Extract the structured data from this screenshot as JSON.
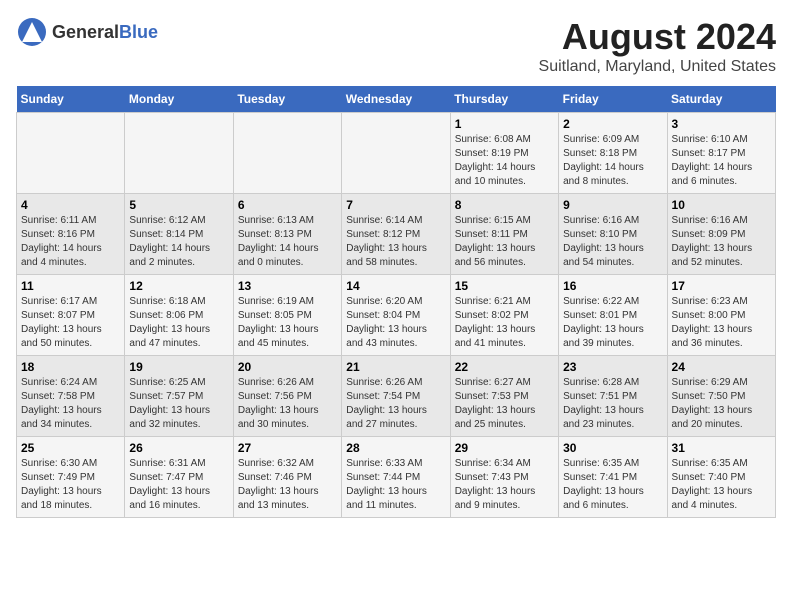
{
  "logo": {
    "general": "General",
    "blue": "Blue"
  },
  "title": "August 2024",
  "subtitle": "Suitland, Maryland, United States",
  "days_of_week": [
    "Sunday",
    "Monday",
    "Tuesday",
    "Wednesday",
    "Thursday",
    "Friday",
    "Saturday"
  ],
  "weeks": [
    [
      {
        "day": "",
        "info": ""
      },
      {
        "day": "",
        "info": ""
      },
      {
        "day": "",
        "info": ""
      },
      {
        "day": "",
        "info": ""
      },
      {
        "day": "1",
        "info": "Sunrise: 6:08 AM\nSunset: 8:19 PM\nDaylight: 14 hours and 10 minutes."
      },
      {
        "day": "2",
        "info": "Sunrise: 6:09 AM\nSunset: 8:18 PM\nDaylight: 14 hours and 8 minutes."
      },
      {
        "day": "3",
        "info": "Sunrise: 6:10 AM\nSunset: 8:17 PM\nDaylight: 14 hours and 6 minutes."
      }
    ],
    [
      {
        "day": "4",
        "info": "Sunrise: 6:11 AM\nSunset: 8:16 PM\nDaylight: 14 hours and 4 minutes."
      },
      {
        "day": "5",
        "info": "Sunrise: 6:12 AM\nSunset: 8:14 PM\nDaylight: 14 hours and 2 minutes."
      },
      {
        "day": "6",
        "info": "Sunrise: 6:13 AM\nSunset: 8:13 PM\nDaylight: 14 hours and 0 minutes."
      },
      {
        "day": "7",
        "info": "Sunrise: 6:14 AM\nSunset: 8:12 PM\nDaylight: 13 hours and 58 minutes."
      },
      {
        "day": "8",
        "info": "Sunrise: 6:15 AM\nSunset: 8:11 PM\nDaylight: 13 hours and 56 minutes."
      },
      {
        "day": "9",
        "info": "Sunrise: 6:16 AM\nSunset: 8:10 PM\nDaylight: 13 hours and 54 minutes."
      },
      {
        "day": "10",
        "info": "Sunrise: 6:16 AM\nSunset: 8:09 PM\nDaylight: 13 hours and 52 minutes."
      }
    ],
    [
      {
        "day": "11",
        "info": "Sunrise: 6:17 AM\nSunset: 8:07 PM\nDaylight: 13 hours and 50 minutes."
      },
      {
        "day": "12",
        "info": "Sunrise: 6:18 AM\nSunset: 8:06 PM\nDaylight: 13 hours and 47 minutes."
      },
      {
        "day": "13",
        "info": "Sunrise: 6:19 AM\nSunset: 8:05 PM\nDaylight: 13 hours and 45 minutes."
      },
      {
        "day": "14",
        "info": "Sunrise: 6:20 AM\nSunset: 8:04 PM\nDaylight: 13 hours and 43 minutes."
      },
      {
        "day": "15",
        "info": "Sunrise: 6:21 AM\nSunset: 8:02 PM\nDaylight: 13 hours and 41 minutes."
      },
      {
        "day": "16",
        "info": "Sunrise: 6:22 AM\nSunset: 8:01 PM\nDaylight: 13 hours and 39 minutes."
      },
      {
        "day": "17",
        "info": "Sunrise: 6:23 AM\nSunset: 8:00 PM\nDaylight: 13 hours and 36 minutes."
      }
    ],
    [
      {
        "day": "18",
        "info": "Sunrise: 6:24 AM\nSunset: 7:58 PM\nDaylight: 13 hours and 34 minutes."
      },
      {
        "day": "19",
        "info": "Sunrise: 6:25 AM\nSunset: 7:57 PM\nDaylight: 13 hours and 32 minutes."
      },
      {
        "day": "20",
        "info": "Sunrise: 6:26 AM\nSunset: 7:56 PM\nDaylight: 13 hours and 30 minutes."
      },
      {
        "day": "21",
        "info": "Sunrise: 6:26 AM\nSunset: 7:54 PM\nDaylight: 13 hours and 27 minutes."
      },
      {
        "day": "22",
        "info": "Sunrise: 6:27 AM\nSunset: 7:53 PM\nDaylight: 13 hours and 25 minutes."
      },
      {
        "day": "23",
        "info": "Sunrise: 6:28 AM\nSunset: 7:51 PM\nDaylight: 13 hours and 23 minutes."
      },
      {
        "day": "24",
        "info": "Sunrise: 6:29 AM\nSunset: 7:50 PM\nDaylight: 13 hours and 20 minutes."
      }
    ],
    [
      {
        "day": "25",
        "info": "Sunrise: 6:30 AM\nSunset: 7:49 PM\nDaylight: 13 hours and 18 minutes."
      },
      {
        "day": "26",
        "info": "Sunrise: 6:31 AM\nSunset: 7:47 PM\nDaylight: 13 hours and 16 minutes."
      },
      {
        "day": "27",
        "info": "Sunrise: 6:32 AM\nSunset: 7:46 PM\nDaylight: 13 hours and 13 minutes."
      },
      {
        "day": "28",
        "info": "Sunrise: 6:33 AM\nSunset: 7:44 PM\nDaylight: 13 hours and 11 minutes."
      },
      {
        "day": "29",
        "info": "Sunrise: 6:34 AM\nSunset: 7:43 PM\nDaylight: 13 hours and 9 minutes."
      },
      {
        "day": "30",
        "info": "Sunrise: 6:35 AM\nSunset: 7:41 PM\nDaylight: 13 hours and 6 minutes."
      },
      {
        "day": "31",
        "info": "Sunrise: 6:35 AM\nSunset: 7:40 PM\nDaylight: 13 hours and 4 minutes."
      }
    ]
  ]
}
